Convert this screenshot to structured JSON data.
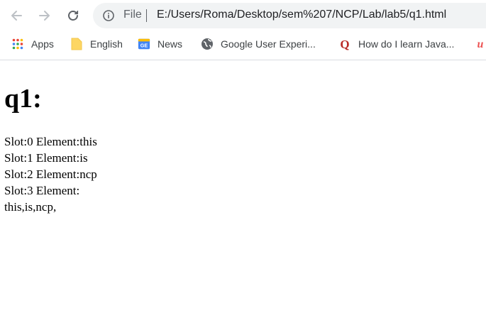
{
  "browser": {
    "address_scheme": "File",
    "address_url": "E:/Users/Roma/Desktop/sem%207/NCP/Lab/lab5/q1.html",
    "bookmarks": [
      {
        "label": "Apps",
        "icon": "apps-grid-icon"
      },
      {
        "label": "English",
        "icon": "folder-icon"
      },
      {
        "label": "News",
        "icon": "google-news-icon"
      },
      {
        "label": "Google User Experi...",
        "icon": "globe-icon"
      },
      {
        "label": "How do I learn Java...",
        "icon": "quora-icon"
      }
    ]
  },
  "page": {
    "title": "q1:",
    "lines": [
      "Slot:0 Element:this",
      "Slot:1 Element:is",
      "Slot:2 Element:ncp",
      "Slot:3 Element:",
      "this,is,ncp,"
    ]
  },
  "colors": {
    "omnibox_bg": "#f1f3f4",
    "icon_gray": "#5f6368",
    "folder_yellow": "#fdd663",
    "quora_red": "#b92b27"
  }
}
